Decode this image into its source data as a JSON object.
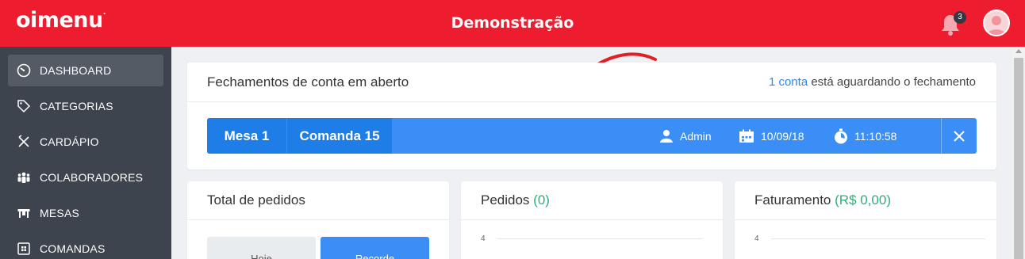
{
  "header": {
    "logo_text": "oimenu",
    "title": "Demonstração",
    "notifications_count": "3",
    "brand_color": "#ee1c2f"
  },
  "sidebar": {
    "items": [
      {
        "label": "DASHBOARD",
        "icon": "dashboard-gauge-icon",
        "active": true
      },
      {
        "label": "CATEGORIAS",
        "icon": "tag-icon",
        "active": false
      },
      {
        "label": "CARDÁPIO",
        "icon": "utensils-icon",
        "active": false
      },
      {
        "label": "COLABORADORES",
        "icon": "users-icon",
        "active": false
      },
      {
        "label": "MESAS",
        "icon": "table-icon",
        "active": false
      },
      {
        "label": "COMANDAS",
        "icon": "order-slip-icon",
        "active": false
      }
    ]
  },
  "closing": {
    "title": "Fechamentos de conta em aberto",
    "note_link": "1 conta",
    "note_rest": " está aguardando o fechamento",
    "row": {
      "mesa": "Mesa 1",
      "comanda": "Comanda 15",
      "user": "Admin",
      "date": "10/09/18",
      "time": "11:10:58"
    }
  },
  "cards": {
    "total": {
      "title": "Total de pedidos",
      "btn_left": "Hoje",
      "btn_right": "Recorde"
    },
    "pedidos": {
      "title": "Pedidos",
      "value": "(0)",
      "tick": "4"
    },
    "faturamento": {
      "title": "Faturamento",
      "value": "(R$ 0,00)",
      "tick": "4"
    }
  }
}
